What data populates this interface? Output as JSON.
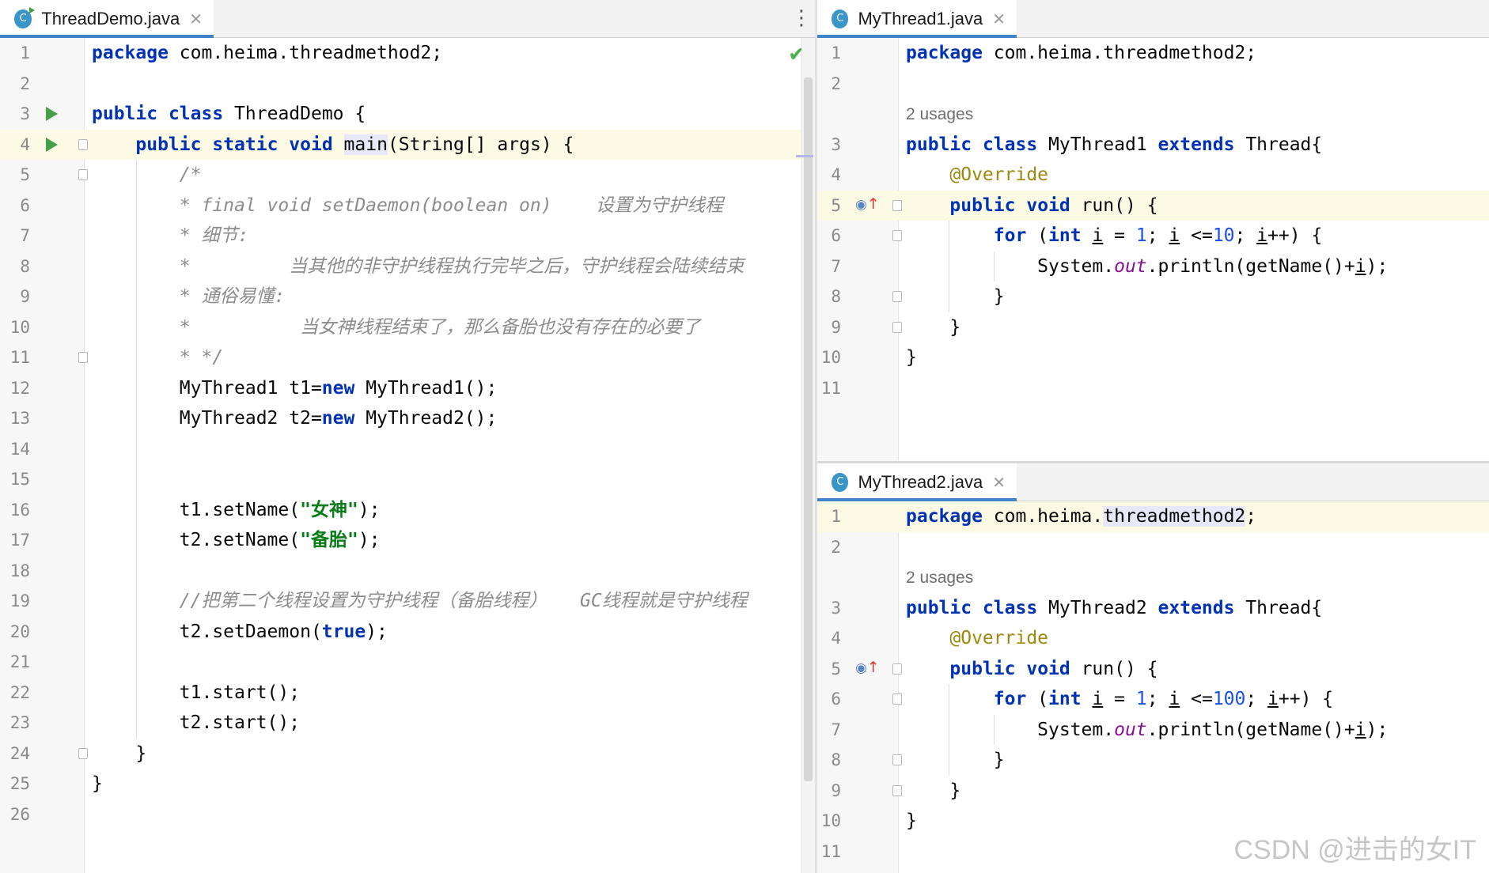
{
  "left_editor": {
    "tab": {
      "label": "ThreadDemo.java",
      "close": "✕",
      "icon": "C"
    },
    "more_icon": "⋮",
    "status_check": "✔",
    "lines": [
      {
        "n": "1",
        "t": [
          [
            "kw",
            "package"
          ],
          [
            "p",
            " com.heima.threadmethod2;"
          ]
        ]
      },
      {
        "n": "2",
        "t": []
      },
      {
        "n": "3",
        "t": [
          [
            "kw",
            "public"
          ],
          [
            "p",
            " "
          ],
          [
            "kw",
            "class"
          ],
          [
            "p",
            " ThreadDemo {"
          ]
        ]
      },
      {
        "n": "4",
        "t": [
          [
            "p",
            "    "
          ],
          [
            "kw",
            "public"
          ],
          [
            "p",
            " "
          ],
          [
            "kw",
            "static"
          ],
          [
            "p",
            " "
          ],
          [
            "kw",
            "void"
          ],
          [
            "p",
            " "
          ],
          [
            "mhl",
            "main"
          ],
          [
            "p",
            "(String[] args) {"
          ]
        ]
      },
      {
        "n": "5",
        "t": [
          [
            "cm",
            "        /*"
          ]
        ]
      },
      {
        "n": "6",
        "t": [
          [
            "cm",
            "        * final void setDaemon(boolean on)    设置为守护线程"
          ]
        ]
      },
      {
        "n": "7",
        "t": [
          [
            "cm",
            "        * 细节:"
          ]
        ]
      },
      {
        "n": "8",
        "t": [
          [
            "cm",
            "        *         当其他的非守护线程执行完毕之后，守护线程会陆续结束"
          ]
        ]
      },
      {
        "n": "9",
        "t": [
          [
            "cm",
            "        * 通俗易懂:"
          ]
        ]
      },
      {
        "n": "10",
        "t": [
          [
            "cm",
            "        *          当女神线程结束了，那么备胎也没有存在的必要了"
          ]
        ]
      },
      {
        "n": "11",
        "t": [
          [
            "cm",
            "        * */"
          ]
        ]
      },
      {
        "n": "12",
        "t": [
          [
            "p",
            "        MyThread1 t1="
          ],
          [
            "kw",
            "new"
          ],
          [
            "p",
            " MyThread1();"
          ]
        ]
      },
      {
        "n": "13",
        "t": [
          [
            "p",
            "        MyThread2 t2="
          ],
          [
            "kw",
            "new"
          ],
          [
            "p",
            " MyThread2();"
          ]
        ]
      },
      {
        "n": "14",
        "t": []
      },
      {
        "n": "15",
        "t": []
      },
      {
        "n": "16",
        "t": [
          [
            "p",
            "        t1.setName("
          ],
          [
            "str",
            "\"女神\""
          ],
          [
            "p",
            ");"
          ]
        ]
      },
      {
        "n": "17",
        "t": [
          [
            "p",
            "        t2.setName("
          ],
          [
            "str",
            "\"备胎\""
          ],
          [
            "p",
            ");"
          ]
        ]
      },
      {
        "n": "18",
        "t": []
      },
      {
        "n": "19",
        "t": [
          [
            "cm",
            "        //把第二个线程设置为守护线程（备胎线程）   GC线程就是守护线程"
          ]
        ]
      },
      {
        "n": "20",
        "t": [
          [
            "p",
            "        t2.setDaemon("
          ],
          [
            "kw",
            "true"
          ],
          [
            "p",
            ");"
          ]
        ]
      },
      {
        "n": "21",
        "t": []
      },
      {
        "n": "22",
        "t": [
          [
            "p",
            "        t1.start();"
          ]
        ]
      },
      {
        "n": "23",
        "t": [
          [
            "p",
            "        t2.start();"
          ]
        ]
      },
      {
        "n": "24",
        "t": [
          [
            "p",
            "    }"
          ]
        ]
      },
      {
        "n": "25",
        "t": [
          [
            "p",
            "}"
          ]
        ]
      },
      {
        "n": "26",
        "t": []
      }
    ]
  },
  "right_top_editor": {
    "tab": {
      "label": "MyThread1.java",
      "close": "✕",
      "icon": "C"
    },
    "lines": [
      {
        "n": "1",
        "t": [
          [
            "kw",
            "package"
          ],
          [
            "p",
            " com.heima.threadmethod2;"
          ]
        ]
      },
      {
        "n": "2",
        "t": []
      },
      {
        "n": "",
        "t": [
          [
            "usage",
            "2 usages"
          ]
        ]
      },
      {
        "n": "3",
        "t": [
          [
            "kw",
            "public"
          ],
          [
            "p",
            " "
          ],
          [
            "kw",
            "class"
          ],
          [
            "p",
            " MyThread1 "
          ],
          [
            "kw",
            "extends"
          ],
          [
            "p",
            " Thread{"
          ]
        ]
      },
      {
        "n": "4",
        "t": [
          [
            "ann",
            "    @Override"
          ]
        ]
      },
      {
        "n": "5",
        "t": [
          [
            "p",
            "    "
          ],
          [
            "kw",
            "public"
          ],
          [
            "p",
            " "
          ],
          [
            "kw",
            "void"
          ],
          [
            "p",
            " run() {"
          ]
        ]
      },
      {
        "n": "6",
        "t": [
          [
            "p",
            "        "
          ],
          [
            "kw",
            "for"
          ],
          [
            "p",
            " ("
          ],
          [
            "kw",
            "int"
          ],
          [
            "p",
            " "
          ],
          [
            "ul",
            "i"
          ],
          [
            "p",
            " = "
          ],
          [
            "num",
            "1"
          ],
          [
            "p",
            "; "
          ],
          [
            "ul",
            "i"
          ],
          [
            "p",
            " <="
          ],
          [
            "num",
            "10"
          ],
          [
            "p",
            "; "
          ],
          [
            "ul",
            "i"
          ],
          [
            "p",
            "++) {"
          ]
        ]
      },
      {
        "n": "7",
        "t": [
          [
            "p",
            "            System."
          ],
          [
            "st",
            "out"
          ],
          [
            "p",
            ".println(getName()+"
          ],
          [
            "ul",
            "i"
          ],
          [
            "p",
            ");"
          ]
        ]
      },
      {
        "n": "8",
        "t": [
          [
            "p",
            "        }"
          ]
        ]
      },
      {
        "n": "9",
        "t": [
          [
            "p",
            "    }"
          ]
        ]
      },
      {
        "n": "10",
        "t": [
          [
            "p",
            "}"
          ]
        ]
      },
      {
        "n": "11",
        "t": []
      }
    ]
  },
  "right_bottom_editor": {
    "tab": {
      "label": "MyThread2.java",
      "close": "✕",
      "icon": "C"
    },
    "lines": [
      {
        "n": "1",
        "t": [
          [
            "kw",
            "package"
          ],
          [
            "p",
            " com.heima."
          ],
          [
            "mhl",
            "threadmethod2"
          ],
          [
            "p",
            ";"
          ]
        ]
      },
      {
        "n": "2",
        "t": []
      },
      {
        "n": "",
        "t": [
          [
            "usage",
            "2 usages"
          ]
        ]
      },
      {
        "n": "3",
        "t": [
          [
            "kw",
            "public"
          ],
          [
            "p",
            " "
          ],
          [
            "kw",
            "class"
          ],
          [
            "p",
            " MyThread2 "
          ],
          [
            "kw",
            "extends"
          ],
          [
            "p",
            " Thread{"
          ]
        ]
      },
      {
        "n": "4",
        "t": [
          [
            "ann",
            "    @Override"
          ]
        ]
      },
      {
        "n": "5",
        "t": [
          [
            "p",
            "    "
          ],
          [
            "kw",
            "public"
          ],
          [
            "p",
            " "
          ],
          [
            "kw",
            "void"
          ],
          [
            "p",
            " run() {"
          ]
        ]
      },
      {
        "n": "6",
        "t": [
          [
            "p",
            "        "
          ],
          [
            "kw",
            "for"
          ],
          [
            "p",
            " ("
          ],
          [
            "kw",
            "int"
          ],
          [
            "p",
            " "
          ],
          [
            "ul",
            "i"
          ],
          [
            "p",
            " = "
          ],
          [
            "num",
            "1"
          ],
          [
            "p",
            "; "
          ],
          [
            "ul",
            "i"
          ],
          [
            "p",
            " <="
          ],
          [
            "num",
            "100"
          ],
          [
            "p",
            "; "
          ],
          [
            "ul",
            "i"
          ],
          [
            "p",
            "++) {"
          ]
        ]
      },
      {
        "n": "7",
        "t": [
          [
            "p",
            "            System."
          ],
          [
            "st",
            "out"
          ],
          [
            "p",
            ".println(getName()+"
          ],
          [
            "ul",
            "i"
          ],
          [
            "p",
            ");"
          ]
        ]
      },
      {
        "n": "8",
        "t": [
          [
            "p",
            "        }"
          ]
        ]
      },
      {
        "n": "9",
        "t": [
          [
            "p",
            "    }"
          ]
        ]
      },
      {
        "n": "10",
        "t": [
          [
            "p",
            "}"
          ]
        ]
      },
      {
        "n": "11",
        "t": []
      }
    ]
  },
  "watermark": "CSDN @进击的女IT",
  "colors": {
    "keyword": "#0033b3",
    "string": "#067d17",
    "number": "#1750eb",
    "comment": "#8c8c8c",
    "annotation": "#9e880d",
    "current_line": "#fcf9e5",
    "tab_underline": "#4083c9"
  }
}
